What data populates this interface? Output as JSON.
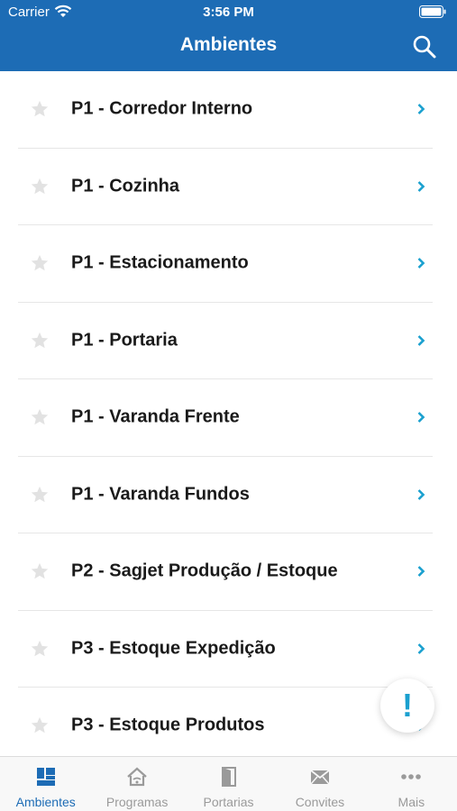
{
  "status_bar": {
    "carrier": "Carrier",
    "time": "3:56 PM"
  },
  "header": {
    "title": "Ambientes",
    "search_icon": "search-icon"
  },
  "colors": {
    "header": "#1d6cb5",
    "accent": "#1aa0cf",
    "star": "#e2e2e2",
    "tab_inactive": "#9a9a9a"
  },
  "list": {
    "items": [
      {
        "label": "P1 - Corredor Interno"
      },
      {
        "label": "P1 - Cozinha"
      },
      {
        "label": "P1 - Estacionamento"
      },
      {
        "label": "P1 - Portaria"
      },
      {
        "label": "P1 - Varanda Frente"
      },
      {
        "label": "P1 - Varanda Fundos"
      },
      {
        "label": "P2 - Sagjet Produção / Estoque"
      },
      {
        "label": "P3 - Estoque Expedição"
      },
      {
        "label": "P3 - Estoque Produtos"
      }
    ]
  },
  "fab": {
    "label": "!"
  },
  "tabbar": {
    "active": "Ambientes",
    "tabs": [
      {
        "label": "Ambientes",
        "icon": "grid-icon"
      },
      {
        "label": "Programas",
        "icon": "home-wifi-icon"
      },
      {
        "label": "Portarias",
        "icon": "door-icon"
      },
      {
        "label": "Convites",
        "icon": "envelope-icon"
      },
      {
        "label": "Mais",
        "icon": "more-icon"
      }
    ]
  }
}
